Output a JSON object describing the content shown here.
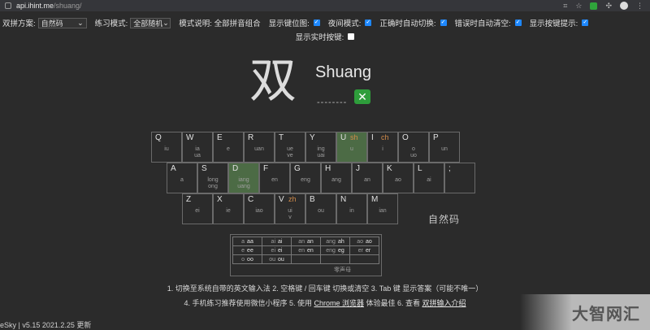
{
  "browser": {
    "url_host": "api.ihint.me",
    "url_path": "/shuang/"
  },
  "settings": {
    "scheme_label": "双拼方案:",
    "scheme_value": "自然码",
    "mode_label": "练习模式:",
    "mode_value": "全部随机",
    "desc_label": "模式说明:",
    "desc_value": "全部拼音组合",
    "opt_keypos": "显示键位图:",
    "opt_night": "夜间模式:",
    "opt_autonext": "正确时自动切换:",
    "opt_autoclear": "错误时自动清空:",
    "opt_hint": "显示按键提示:",
    "opt_realtime": "显示实时按键:",
    "checked": {
      "keypos": true,
      "night": true,
      "autonext": true,
      "autoclear": true,
      "hint": true,
      "realtime": false
    }
  },
  "practice": {
    "hanzi": "双",
    "pinyin": "Shuang",
    "input_mask": "--------",
    "status_icon": "x-icon"
  },
  "keyboard": {
    "scheme_name": "自然码",
    "row1": [
      {
        "k": "Q",
        "s": "",
        "f1": "iu",
        "f2": ""
      },
      {
        "k": "W",
        "s": "",
        "f1": "ia",
        "f2": "ua"
      },
      {
        "k": "E",
        "s": "",
        "f1": "e",
        "f2": ""
      },
      {
        "k": "R",
        "s": "",
        "f1": "uan",
        "f2": ""
      },
      {
        "k": "T",
        "s": "",
        "f1": "ue",
        "f2": "ve"
      },
      {
        "k": "Y",
        "s": "",
        "f1": "ing",
        "f2": "uai"
      },
      {
        "k": "U",
        "s": "sh",
        "f1": "u",
        "f2": "",
        "hl": true
      },
      {
        "k": "I",
        "s": "ch",
        "f1": "i",
        "f2": ""
      },
      {
        "k": "O",
        "s": "",
        "f1": "o",
        "f2": "uo"
      },
      {
        "k": "P",
        "s": "",
        "f1": "un",
        "f2": ""
      }
    ],
    "row2": [
      {
        "k": "A",
        "s": "",
        "f1": "a",
        "f2": ""
      },
      {
        "k": "S",
        "s": "",
        "f1": "long",
        "f2": "ong"
      },
      {
        "k": "D",
        "s": "",
        "f1": "iang",
        "f2": "uang",
        "hl": true
      },
      {
        "k": "F",
        "s": "",
        "f1": "en",
        "f2": ""
      },
      {
        "k": "G",
        "s": "",
        "f1": "eng",
        "f2": ""
      },
      {
        "k": "H",
        "s": "",
        "f1": "ang",
        "f2": ""
      },
      {
        "k": "J",
        "s": "",
        "f1": "an",
        "f2": ""
      },
      {
        "k": "K",
        "s": "",
        "f1": "ao",
        "f2": ""
      },
      {
        "k": "L",
        "s": "",
        "f1": "ai",
        "f2": ""
      },
      {
        "k": ";",
        "s": "",
        "f1": "",
        "f2": ""
      }
    ],
    "row3": [
      {
        "k": "Z",
        "s": "",
        "f1": "ei",
        "f2": ""
      },
      {
        "k": "X",
        "s": "",
        "f1": "ie",
        "f2": ""
      },
      {
        "k": "C",
        "s": "",
        "f1": "iao",
        "f2": ""
      },
      {
        "k": "V",
        "s": "zh",
        "f1": "ui",
        "f2": "v"
      },
      {
        "k": "B",
        "s": "",
        "f1": "ou",
        "f2": ""
      },
      {
        "k": "N",
        "s": "",
        "f1": "in",
        "f2": ""
      },
      {
        "k": "M",
        "s": "",
        "f1": "ian",
        "f2": ""
      }
    ]
  },
  "zero_initial": {
    "rows": [
      [
        [
          "a",
          "aa"
        ],
        [
          "ai",
          "ai"
        ],
        [
          "an",
          "an"
        ],
        [
          "ang",
          "ah"
        ],
        [
          "ao",
          "ao"
        ]
      ],
      [
        [
          "e",
          "ee"
        ],
        [
          "ei",
          "ei"
        ],
        [
          "en",
          "en"
        ],
        [
          "eng",
          "eg"
        ],
        [
          "er",
          "er"
        ]
      ],
      [
        [
          "o",
          "oo"
        ],
        [
          "ou",
          "ou"
        ],
        [
          "",
          ""
        ],
        [
          "",
          ""
        ],
        [
          "",
          ""
        ]
      ]
    ],
    "caption": "零声母"
  },
  "tips": {
    "line1": "1. 切换至系统自带的英文输入法   2. 空格键 / 回车键 切换或清空   3. Tab 键 显示答案（可能不唯一）",
    "line2_a": "4. 手机练习推荐使用微信小程序   5. 使用 ",
    "line2_link1": "Chrome 浏览器",
    "line2_b": " 体验最佳   6. 查看 ",
    "line2_link2": "双拼输入介绍"
  },
  "footer": "eSky | v5.15 2021.2.25 更新",
  "watermark": "大智网汇"
}
